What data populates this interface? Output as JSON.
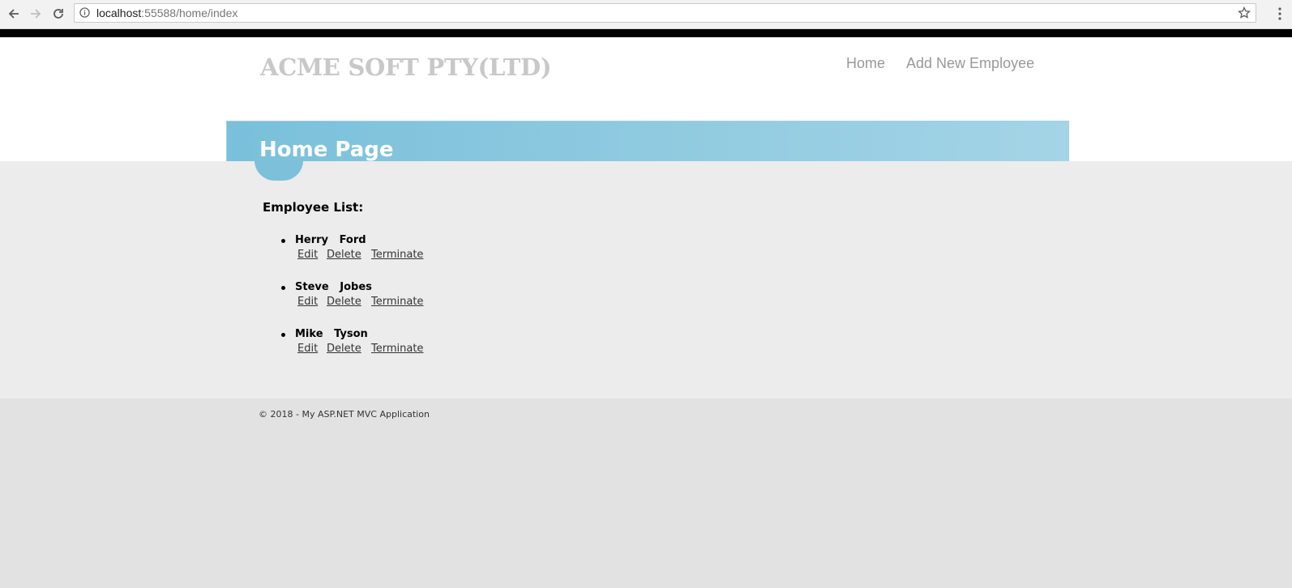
{
  "browser": {
    "url_host": "localhost",
    "url_path": ":55588/home/index"
  },
  "header": {
    "site_title": "ACME SOFT PTY(LTD)",
    "nav": {
      "home": "Home",
      "add_employee": "Add New Employee"
    },
    "page_title": "Home Page"
  },
  "main": {
    "section_title": "Employee List:",
    "employees": [
      {
        "name": "Herry   Ford"
      },
      {
        "name": "Steve   Jobes"
      },
      {
        "name": "Mike   Tyson"
      }
    ],
    "actions": {
      "edit": "Edit",
      "delete": "Delete",
      "terminate": "Terminate"
    }
  },
  "footer": {
    "text": "© 2018 - My ASP.NET MVC Application"
  },
  "colors": {
    "featured_start": "#7ac0da",
    "featured_end": "#a4d4e6",
    "body_bg": "#ececec",
    "footer_bg": "#e2e2e2"
  }
}
